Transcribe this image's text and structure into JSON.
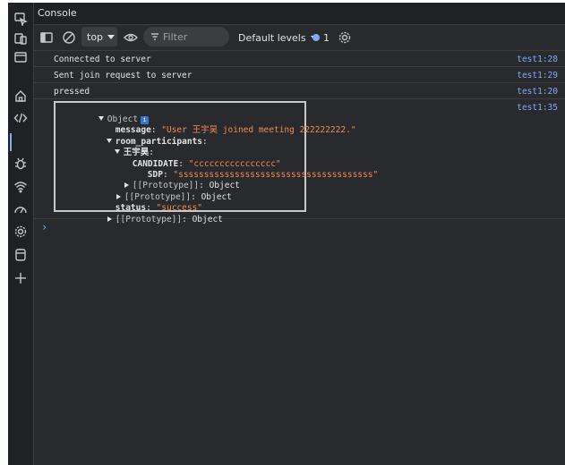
{
  "window": {
    "title": "Console"
  },
  "toolbar": {
    "context_value": "top",
    "filter_placeholder": "Filter",
    "levels_label": "Default levels",
    "issues_count": "1"
  },
  "messages": [
    {
      "text": "Connected to server",
      "source": "test1:28"
    },
    {
      "text": "Sent join request to server",
      "source": "test1:29"
    },
    {
      "text": "pressed",
      "source": "test1:20"
    }
  ],
  "object_log": {
    "source": "test1:35",
    "label": "Object",
    "info_badge": "i",
    "message_key": "message",
    "message_value": "\"User 王宇昊 joined meeting 222222222.\"",
    "room_key": "room_participants",
    "participant_key": "王宇昊",
    "candidate_key": "CANDIDATE",
    "candidate_value": "\"cccccccccccccccc\"",
    "sdp_key": "SDP",
    "sdp_value": "\"ssssssssssssssssssssssssssssssssssssss\"",
    "prototype_key": "[[Prototype]]",
    "prototype_value": "Object",
    "status_key": "status",
    "status_value": "\"success\""
  },
  "prompt_symbol": "›"
}
